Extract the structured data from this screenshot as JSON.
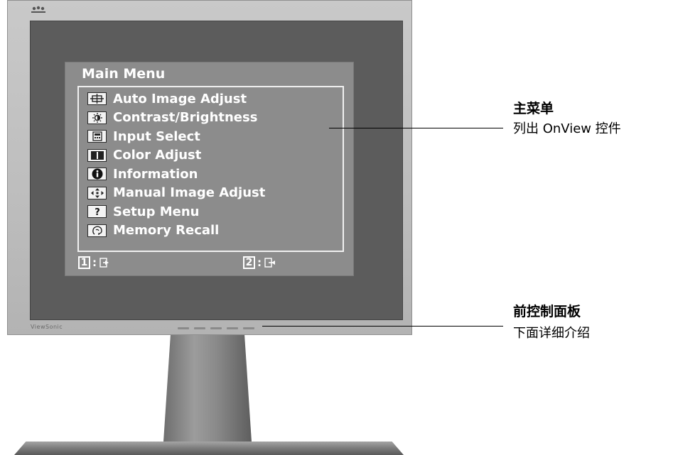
{
  "monitor": {
    "brand": "ViewSonic"
  },
  "osd": {
    "title": "Main Menu",
    "items": [
      {
        "icon": "auto-adjust-icon",
        "label": "Auto Image Adjust"
      },
      {
        "icon": "contrast-brightness-icon",
        "label": "Contrast/Brightness"
      },
      {
        "icon": "input-select-icon",
        "label": "Input Select"
      },
      {
        "icon": "color-adjust-icon",
        "label": "Color Adjust"
      },
      {
        "icon": "information-icon",
        "label": "Information"
      },
      {
        "icon": "manual-adjust-icon",
        "label": "Manual Image Adjust"
      },
      {
        "icon": "setup-menu-icon",
        "label": "Setup Menu"
      },
      {
        "icon": "memory-recall-icon",
        "label": "Memory Recall"
      }
    ],
    "footer": {
      "left_key": "1",
      "right_key": "2",
      "separator": ":"
    }
  },
  "callouts": {
    "main_menu": {
      "title": "主菜单",
      "desc": "列出 OnView 控件"
    },
    "front_panel": {
      "title": "前控制面板",
      "desc": "下面详细介绍"
    }
  }
}
